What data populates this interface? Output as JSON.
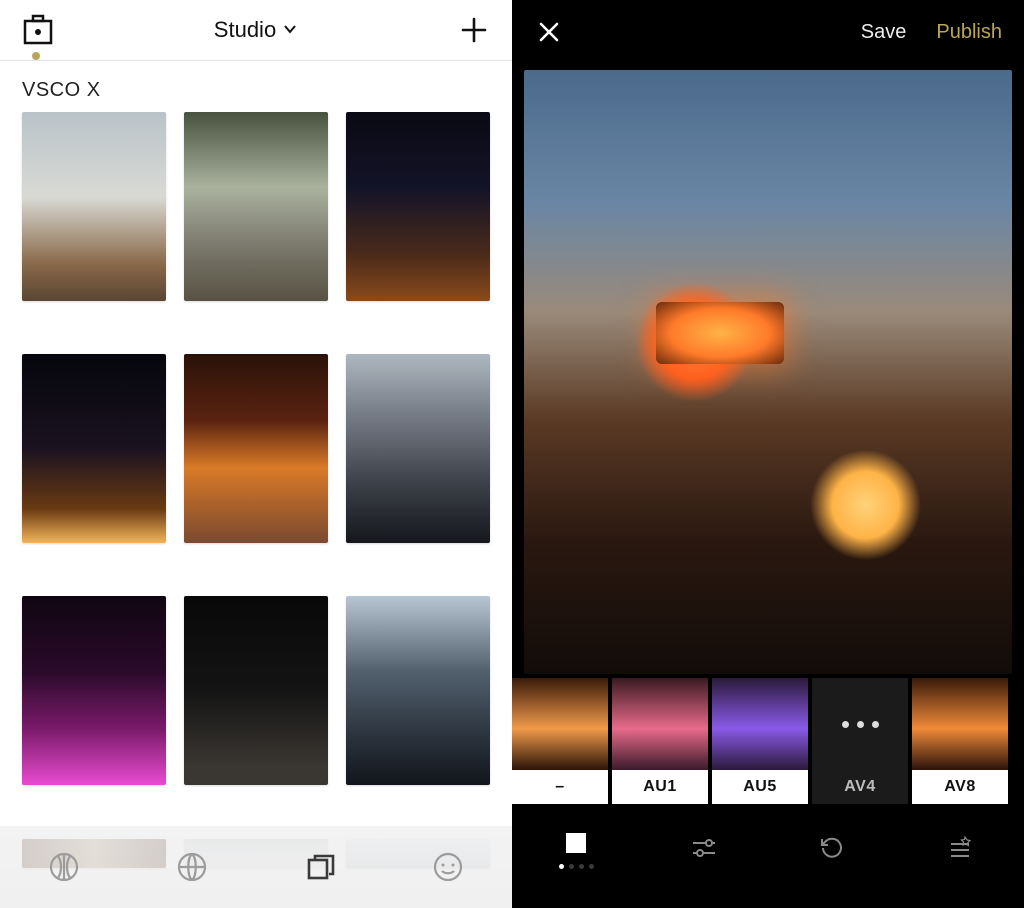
{
  "left": {
    "title": "Studio",
    "section_label": "VSCO X",
    "tabs": [
      "feed",
      "discover",
      "studio",
      "profile"
    ],
    "active_tab_index": 2,
    "thumbnails": [
      {
        "name": "photo-foggy-park"
      },
      {
        "name": "photo-autumn-street"
      },
      {
        "name": "photo-night-city-1"
      },
      {
        "name": "photo-night-city-2"
      },
      {
        "name": "photo-corner-bistro"
      },
      {
        "name": "photo-skyscrapers-dusk"
      },
      {
        "name": "photo-neon-bar"
      },
      {
        "name": "photo-dark-plaza"
      },
      {
        "name": "photo-avenue"
      },
      {
        "name": "photo-shop-front"
      },
      {
        "name": "photo-light-1"
      },
      {
        "name": "photo-light-2"
      }
    ]
  },
  "right": {
    "save_label": "Save",
    "publish_label": "Publish",
    "publish_color": "#b9a65a",
    "filters": [
      {
        "id": "none",
        "label": "–",
        "label_color": "#111",
        "swatch": "sw-base"
      },
      {
        "id": "AU1",
        "label": "AU1",
        "label_color": "#5a4ae0",
        "swatch": "sw-au1"
      },
      {
        "id": "AU5",
        "label": "AU5",
        "label_color": "#7a3ae0",
        "swatch": "sw-au5"
      },
      {
        "id": "AV4",
        "label": "AV4",
        "label_color": "#bdbdbd",
        "swatch": "sw-av4",
        "dark": true,
        "more": true
      },
      {
        "id": "AV8",
        "label": "AV8",
        "label_color": "#d63a3a",
        "swatch": "sw-av8"
      }
    ],
    "bottom_tabs": [
      "presets",
      "adjust",
      "history",
      "recipes"
    ],
    "active_bottom_index": 0,
    "page_dots": 4,
    "active_dot": 0
  }
}
